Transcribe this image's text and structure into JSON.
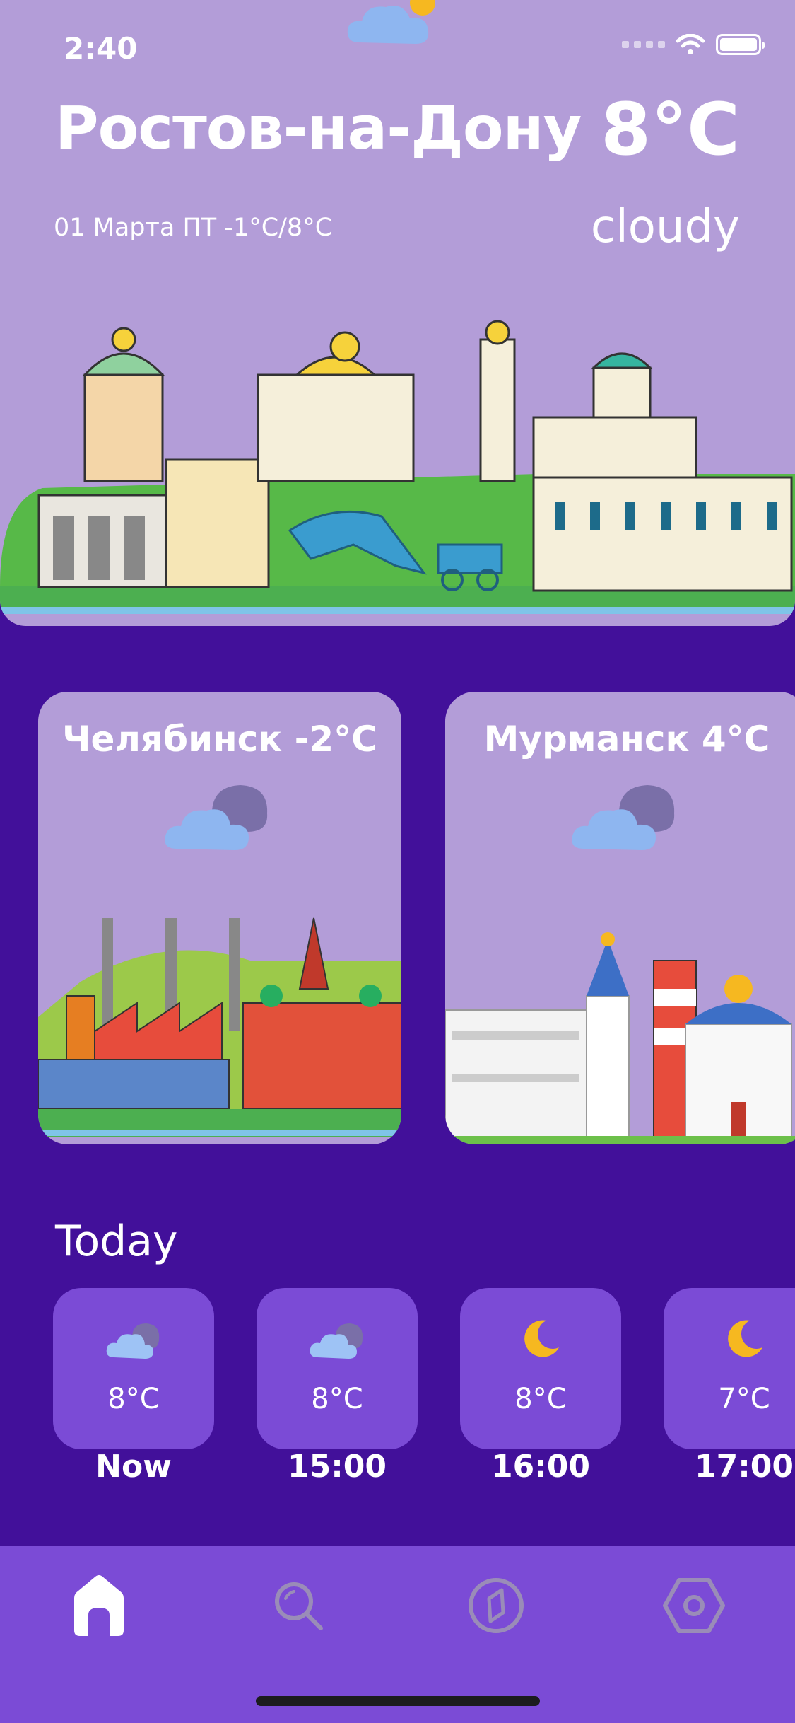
{
  "status": {
    "time": "2:40"
  },
  "hero": {
    "city": "Ростов-на-Дону",
    "temperature": "8°C",
    "date_line": "01 Марта ПТ -1°C/8°C",
    "condition": "cloudy"
  },
  "cards": [
    {
      "title": "Челябинск -2°C",
      "icon": "cloud-icon"
    },
    {
      "title": "Мурманск 4°C",
      "icon": "cloud-icon"
    }
  ],
  "today": {
    "heading": "Today",
    "hours": [
      {
        "temp": "8°C",
        "label": "Now",
        "icon": "cloud-icon"
      },
      {
        "temp": "8°C",
        "label": "15:00",
        "icon": "cloud-icon"
      },
      {
        "temp": "8°C",
        "label": "16:00",
        "icon": "moon-icon"
      },
      {
        "temp": "7°C",
        "label": "17:00",
        "icon": "moon-icon"
      }
    ]
  },
  "tabbar": {
    "tabs": [
      "home-icon",
      "search-icon",
      "compass-icon",
      "settings-icon"
    ],
    "active": "home-icon"
  },
  "colors": {
    "background": "#42109a",
    "card": "#b39dd8",
    "accent": "#7b4bd6",
    "moon": "#f6b820"
  }
}
